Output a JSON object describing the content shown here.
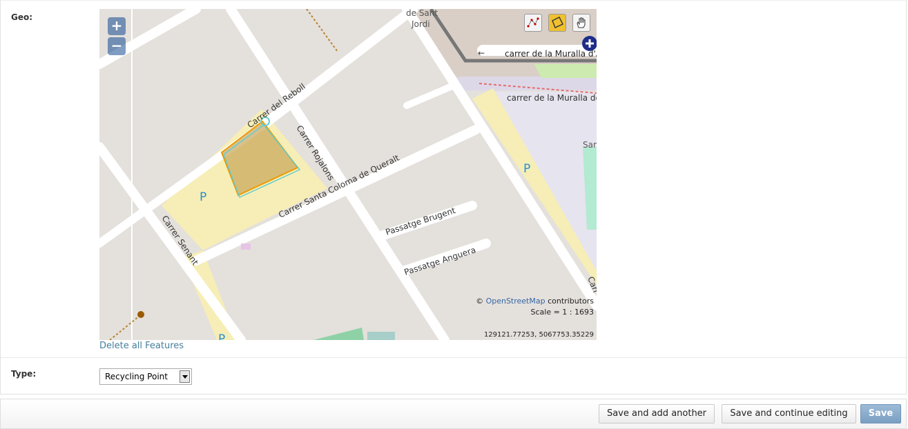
{
  "form": {
    "geo_label": "Geo:",
    "type_label": "Type:",
    "type_value": "Recycling Point",
    "delete_features": "Delete all Features"
  },
  "map": {
    "zoom_in": "+",
    "zoom_out": "−",
    "tools": [
      "draw-line-icon",
      "draw-polygon-icon",
      "pan-hand-icon"
    ],
    "attribution_prefix": "©",
    "attribution_link": "OpenStreetMap",
    "attribution_suffix": "contributors",
    "scale": "Scale = 1 : 1693",
    "coordinates": "129121.77253, 5067753.35229",
    "labels": {
      "street_reboll": "Carrer del Reboll",
      "street_rojalons": "Carrer Rojalons",
      "street_coloma": "Carrer Santa Coloma de Queralt",
      "street_senant": "Carrer Senant",
      "passatge_brugent": "Passatge Brugent",
      "passatge_anguera": "Passatge Anguera",
      "muralla_1": "carrer de la Muralla d'A",
      "muralla_2": "carrer de la Muralla de",
      "de_sant": "de Sant",
      "jordi": "Jordi",
      "sant_partial": "San",
      "carr_partial": "Carr",
      "parking": "P"
    },
    "colors": {
      "background": "#e4e0dc",
      "road": "#ffffff",
      "parking_area": "#f6eeb6",
      "polygon_fill": "#c9a55a",
      "polygon_stroke_orange": "#ee9900",
      "polygon_stroke_cyan": "#66cccc",
      "link_color": "#447e9b"
    }
  },
  "actions": {
    "save_add_another": "Save and add another",
    "save_continue": "Save and continue editing",
    "save": "Save"
  }
}
